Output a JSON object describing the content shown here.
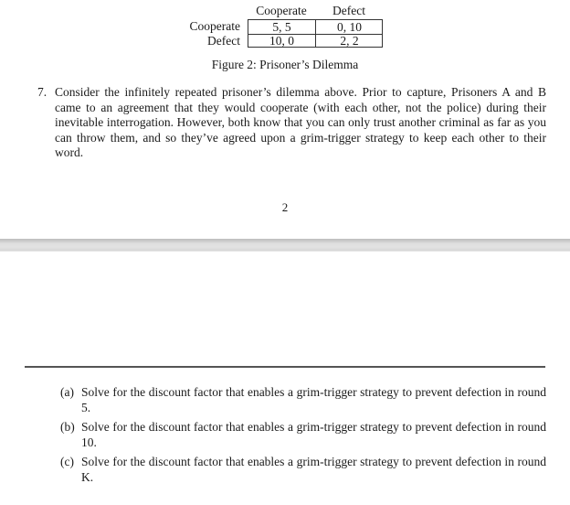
{
  "figure": {
    "column_headers": [
      "Cooperate",
      "Defect"
    ],
    "row_headers": [
      "Cooperate",
      "Defect"
    ],
    "payoffs": [
      [
        "5, 5",
        "0, 10"
      ],
      [
        "10, 0",
        "2, 2"
      ]
    ],
    "caption": "Figure 2: Prisoner’s Dilemma"
  },
  "problem": {
    "number": "7.",
    "text": "Consider the infinitely repeated prisoner’s dilemma above. Prior to capture, Prisoners A and B came to an agreement that they would cooperate (with each other, not the police) during their inevitable interrogation. However, both know that you can only trust another criminal as far as you can throw them, and so they’ve agreed upon a grim-trigger strategy to keep each other to their word."
  },
  "page_number": "2",
  "subquestions": [
    {
      "label": "(a)",
      "text": "Solve for the discount factor that enables a grim-trigger strategy to prevent defection in round 5."
    },
    {
      "label": "(b)",
      "text": "Solve for the discount factor that enables a grim-trigger strategy to prevent defection in round 10."
    },
    {
      "label": "(c)",
      "text": "Solve for the discount factor that enables a grim-trigger strategy to prevent defection in round K."
    }
  ]
}
